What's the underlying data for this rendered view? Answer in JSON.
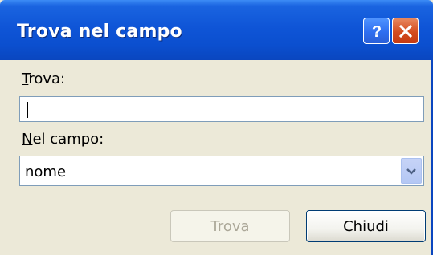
{
  "window": {
    "title": "Trova nel campo"
  },
  "titlebar_buttons": {
    "help_icon": "help-icon",
    "close_icon": "close-icon"
  },
  "find": {
    "label_accel": "T",
    "label_rest": "rova:",
    "value": ""
  },
  "field": {
    "label_accel": "N",
    "label_rest": "el campo:",
    "selected": "nome"
  },
  "buttons": {
    "find_label": "Trova",
    "close_label": "Chiudi"
  },
  "colors": {
    "titlebar": "#0b4fcf",
    "dialog_bg": "#ece9d8",
    "close_button": "#d44c1f"
  }
}
